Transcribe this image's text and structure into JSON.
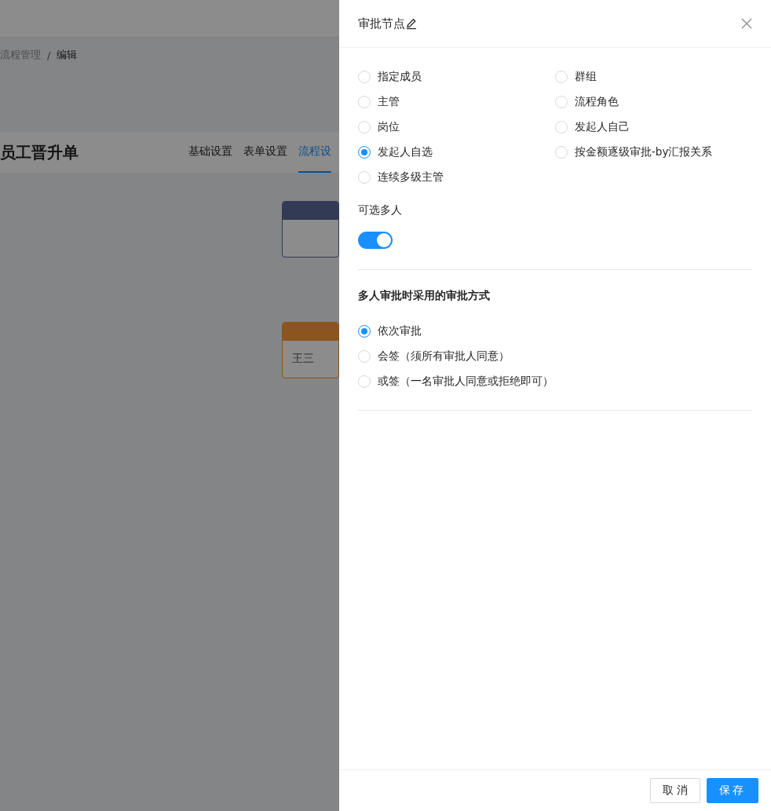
{
  "background": {
    "breadcrumb": [
      {
        "label": "流程管理",
        "current": false
      },
      {
        "label": "编辑",
        "current": true
      }
    ],
    "separator": "/",
    "title": "员工晋升单",
    "tabs": [
      {
        "label": "基础设置",
        "selected": false
      },
      {
        "label": "表单设置",
        "selected": false
      },
      {
        "label": "流程设",
        "selected": true
      }
    ],
    "nodes": [
      {
        "kind": "start"
      },
      {
        "kind": "approver",
        "assignee": "王三"
      }
    ]
  },
  "drawer": {
    "title": "审批节点",
    "approver_types": [
      {
        "label": "指定成员",
        "selected": false
      },
      {
        "label": "群组",
        "selected": false
      },
      {
        "label": "主管",
        "selected": false
      },
      {
        "label": "流程角色",
        "selected": false
      },
      {
        "label": "岗位",
        "selected": false
      },
      {
        "label": "发起人自己",
        "selected": false
      },
      {
        "label": "发起人自选",
        "selected": true
      },
      {
        "label": "按金额逐级审批-by汇报关系",
        "selected": false
      },
      {
        "label": "连续多级主管",
        "selected": false
      }
    ],
    "multi_select": {
      "label": "可选多人",
      "on": true
    },
    "mode_heading": "多人审批时采用的审批方式",
    "modes": [
      {
        "label": "依次审批",
        "selected": true
      },
      {
        "label": "会签（须所有审批人同意）",
        "selected": false
      },
      {
        "label": "或签（一名审批人同意或拒绝即可）",
        "selected": false
      }
    ],
    "buttons": [
      {
        "label": "取 消",
        "kind": "default"
      },
      {
        "label": "保存",
        "kind": "primary"
      }
    ]
  }
}
